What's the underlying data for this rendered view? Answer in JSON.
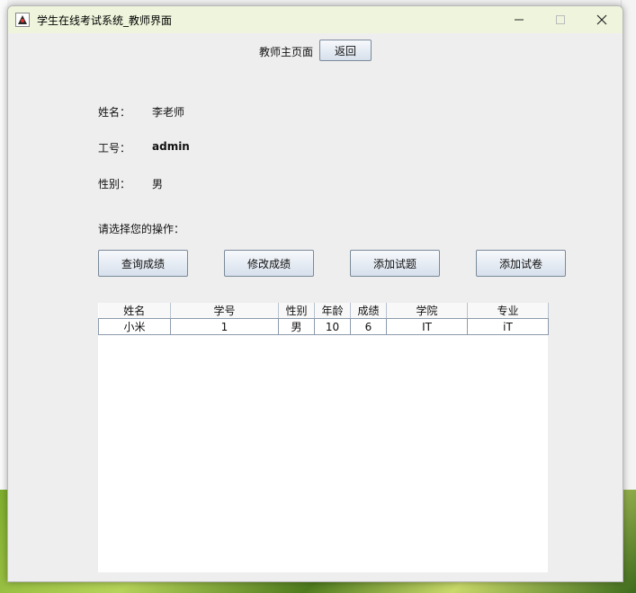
{
  "window": {
    "title": "学生在线考试系统_教师界面",
    "icons": {
      "app": "java-duke-icon",
      "minimize": "minimize-icon",
      "maximize": "maximize-icon",
      "close": "close-icon"
    }
  },
  "header": {
    "label": "教师主页面",
    "back_button": "返回"
  },
  "profile": {
    "name_label": "姓名：",
    "name_value": "李老师",
    "id_label": "工号：",
    "id_value": "admin",
    "gender_label": "性别：",
    "gender_value": "男"
  },
  "actions": {
    "prompt": "请选择您的操作：",
    "buttons": [
      "查询成绩",
      "修改成绩",
      "添加试题",
      "添加试卷"
    ]
  },
  "table": {
    "columns": [
      "姓名",
      "学号",
      "性别",
      "年龄",
      "成绩",
      "学院",
      "专业"
    ],
    "rows": [
      [
        "小米",
        "1",
        "男",
        "10",
        "6",
        "IT",
        "iT"
      ]
    ]
  },
  "colors": {
    "titlebar": "#eef5dc",
    "window_bg": "#eeeeee",
    "button_border": "#7a8a99"
  }
}
